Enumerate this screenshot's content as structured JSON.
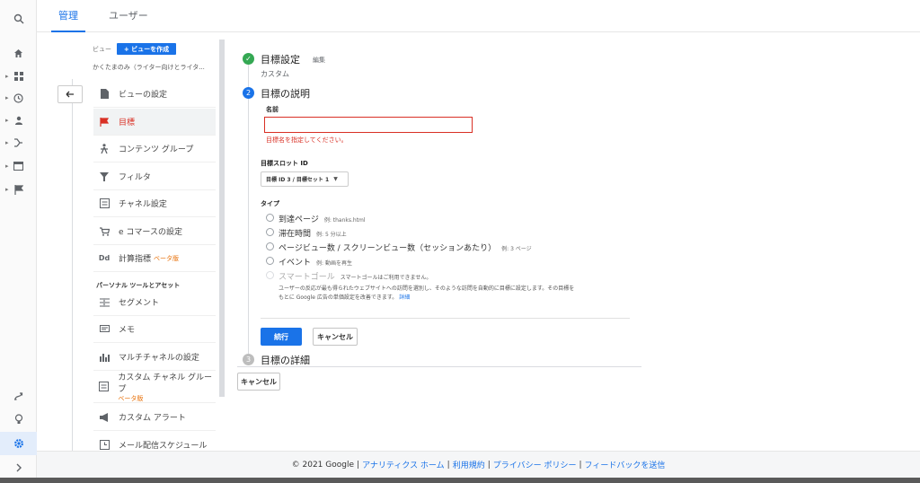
{
  "top_tabs": [
    {
      "label": "管理",
      "active": true
    },
    {
      "label": "ユーザー",
      "active": false
    }
  ],
  "rail": {
    "icons": [
      "search-icon",
      "home-icon",
      "customization-icon",
      "realtime-icon",
      "audience-icon",
      "acquisition-icon",
      "behavior-icon",
      "conversions-icon"
    ],
    "bottom_icons": [
      "attribution-icon",
      "discover-icon",
      "admin-gear-icon",
      "expand-chevron-icon"
    ]
  },
  "view": {
    "label": "ビュー",
    "create_button": "+ ビューを作成",
    "name": "かくたまのみ（ライター向けとライタ..."
  },
  "nav": {
    "items": [
      {
        "label": "ビューの設定",
        "icon": "document-icon",
        "glyph": "▆"
      },
      {
        "label": "目標",
        "icon": "flag-icon",
        "glyph": "⚑",
        "active": true
      },
      {
        "label": "コンテンツ グループ",
        "icon": "person-walk-icon",
        "glyph": "⅄"
      },
      {
        "label": "フィルタ",
        "icon": "filter-icon",
        "glyph": "▼"
      },
      {
        "label": "チャネル設定",
        "icon": "channel-icon",
        "glyph": "▤"
      },
      {
        "label": "e コマースの設定",
        "icon": "cart-icon",
        "glyph": "🛒"
      },
      {
        "label": "計算指標",
        "icon": "calculated-metric-icon",
        "glyph": "Dd",
        "beta": "ベータ版"
      }
    ],
    "section_title": "パーソナル ツールとアセット",
    "personal_items": [
      {
        "label": "セグメント",
        "icon": "segment-icon",
        "glyph": "☰"
      },
      {
        "label": "メモ",
        "icon": "memo-icon",
        "glyph": "▭"
      },
      {
        "label": "マルチチャネルの設定",
        "icon": "bar-chart-icon",
        "glyph": "▥"
      },
      {
        "label": "カスタム チャネル グループ",
        "icon": "channel-group-icon",
        "glyph": "▤",
        "sub": "ベータ版"
      },
      {
        "label": "カスタム アラート",
        "icon": "megaphone-icon",
        "glyph": "◀"
      },
      {
        "label": "メール配信スケジュール",
        "icon": "clock-icon",
        "glyph": "◷"
      }
    ]
  },
  "goal": {
    "step1": {
      "title": "目標設定",
      "edit": "編集",
      "value": "カスタム"
    },
    "step2": {
      "number": "2",
      "title": "目標の説明"
    },
    "name_label": "名前",
    "name_value": "",
    "name_error": "目標名を指定してください。",
    "slot_label": "目標スロット ID",
    "slot_value": "目標 ID 3 / 目標セット 1",
    "type_label": "タイプ",
    "types": [
      {
        "label": "到達ページ",
        "example": "例: thanks.html"
      },
      {
        "label": "滞在時間",
        "example": "例: 5 分以上"
      },
      {
        "label": "ページビュー数 / スクリーンビュー数（セッションあたり）",
        "example": "例: 3 ページ"
      },
      {
        "label": "イベント",
        "example": "例: 動画を再生"
      },
      {
        "label": "スマートゴール",
        "example": "スマートゴールはご利用できません。",
        "disabled": true
      }
    ],
    "smart_desc_1": "ユーザーの反応が最も得られたウェブサイトへの訪問を選別し、そのような訪問を自動的に目標に設定します。その目標を",
    "smart_desc_2": "もとに Google 広告の単価設定を改善できます。",
    "smart_link": "詳細",
    "continue_button": "続行",
    "cancel_button": "キャンセル",
    "step3": {
      "number": "3",
      "title": "目標の詳細"
    },
    "outer_cancel": "キャンセル"
  },
  "footer": {
    "copyright": "© 2021 Google",
    "links": [
      "アナリティクス ホーム",
      "利用規約",
      "プライバシー ポリシー",
      "フィードバックを送信"
    ]
  },
  "colors": {
    "accent": "#1a73e8",
    "error": "#d93025",
    "success": "#34a853",
    "beta": "#e8710a"
  }
}
